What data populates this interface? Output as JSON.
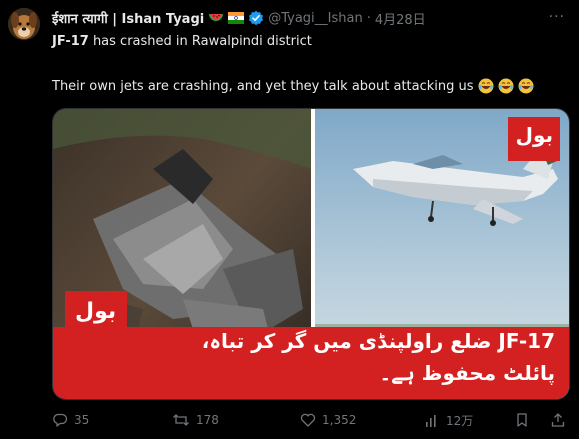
{
  "header": {
    "name": "ईशान त्यागी | Ishan Tyagi",
    "handle": "@Tyagi__Ishan",
    "dot": "·",
    "time": "4月28日",
    "more_label": "···"
  },
  "tweet": {
    "line1_bold": "JF-17",
    "line1_rest": " has crashed in Rawalpindi district",
    "line2": "Their own jets are crashing, and yet they talk about attacking us"
  },
  "media": {
    "logo_top": "بول",
    "logo_bottom": "بول",
    "urdu_line1": "JF-17 ضلع راولپنڈی میں گر کر تباہ،",
    "urdu_line2": "پائلٹ محفوظ ہے۔"
  },
  "actions": {
    "replies": "35",
    "reposts": "178",
    "likes": "1,352",
    "views": "12万"
  },
  "colors": {
    "brand_red": "#d32020",
    "muted": "#71767b",
    "verified_blue": "#1d9bf0"
  }
}
